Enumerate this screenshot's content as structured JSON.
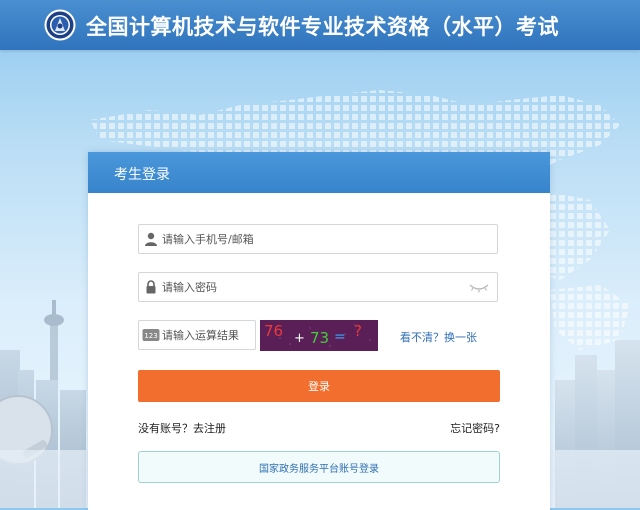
{
  "header": {
    "title": "全国计算机技术与软件专业技术资格（水平）考试"
  },
  "login": {
    "title": "考生登录",
    "account_placeholder": "请输入手机号/邮箱",
    "password_placeholder": "请输入密码",
    "captcha_placeholder": "请输入运算结果",
    "captcha_badge": "123",
    "captcha_text": {
      "a": "76",
      "op": "+",
      "b": "73",
      "eq": "=",
      "q": "?"
    },
    "refresh_captcha": "看不清？换一张",
    "submit": "登录",
    "register": "没有账号？去注册",
    "forgot": "忘记密码?",
    "gov_login": "国家政务服务平台账号登录"
  },
  "colors": {
    "header_bg": "#3a80c6",
    "card_header_bg": "#4090d4",
    "login_button": "#f16e2e",
    "link_blue": "#2f6fb6"
  },
  "icons": [
    "emblem-logo",
    "user-icon",
    "lock-icon",
    "eye-closed-icon",
    "captcha-badge-icon"
  ]
}
